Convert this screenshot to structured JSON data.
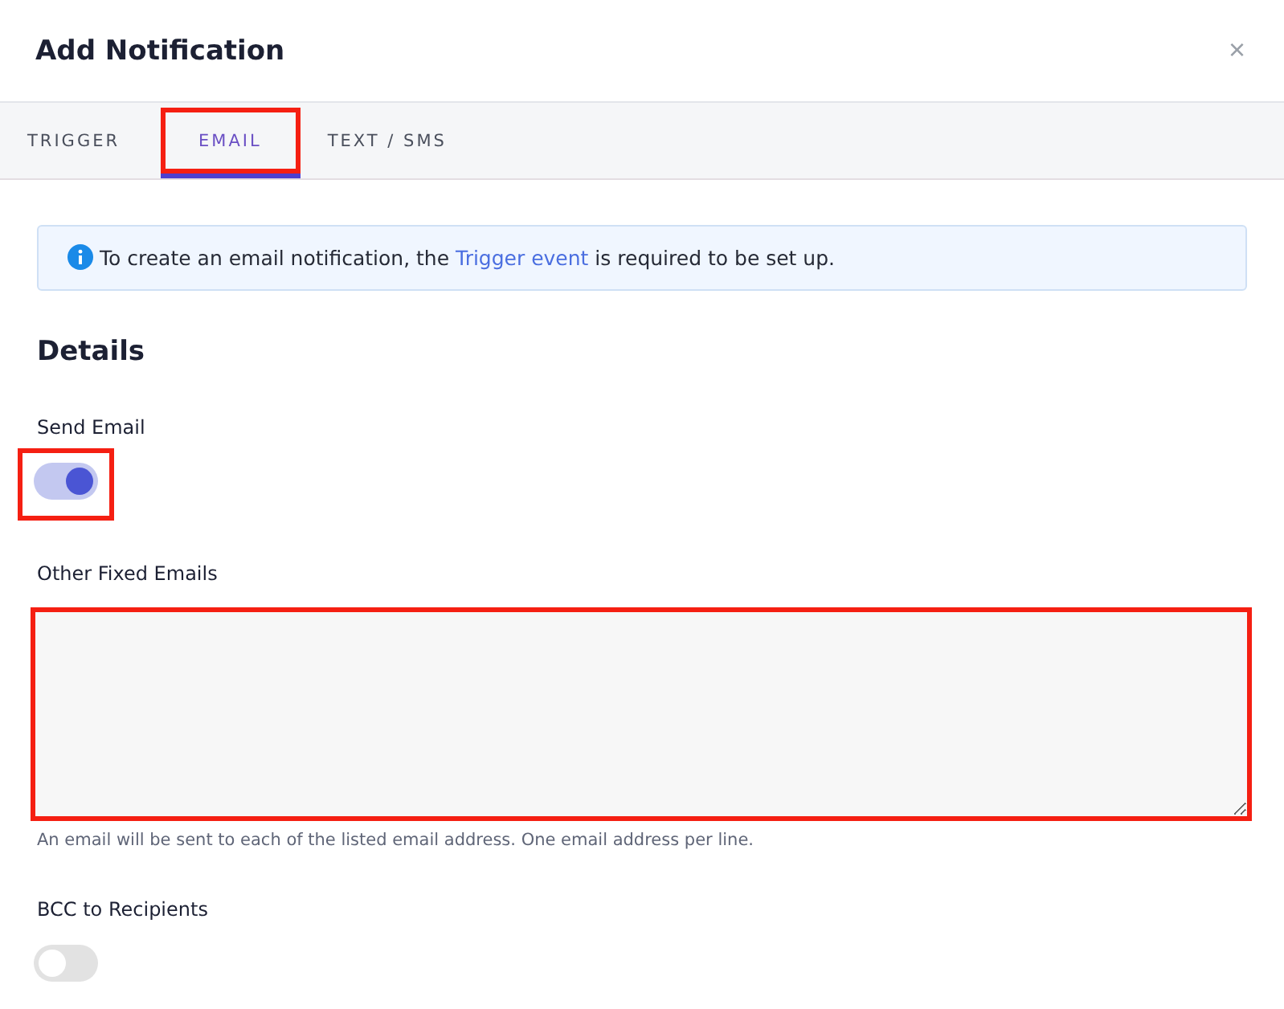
{
  "dialog": {
    "title": "Add Notification",
    "close": "×"
  },
  "tabs": [
    {
      "label": "TRIGGER",
      "selected": false,
      "highlighted": false
    },
    {
      "label": "EMAIL",
      "selected": true,
      "highlighted": true
    },
    {
      "label": "TEXT / SMS",
      "selected": false,
      "highlighted": false
    }
  ],
  "info": {
    "before": "To create an email notification, the ",
    "link": "Trigger event",
    "after": " is required to be set up."
  },
  "section_title": "Details",
  "fields": [
    {
      "kind": "toggle",
      "label": "Send Email",
      "on": true,
      "highlighted": true
    },
    {
      "kind": "textarea",
      "label": "Other Fixed Emails",
      "highlighted": true,
      "help": "An email will be sent to each of the listed email address. One email address per line."
    },
    {
      "kind": "toggle",
      "label": "BCC to Recipients",
      "on": false,
      "highlighted": false
    }
  ]
}
